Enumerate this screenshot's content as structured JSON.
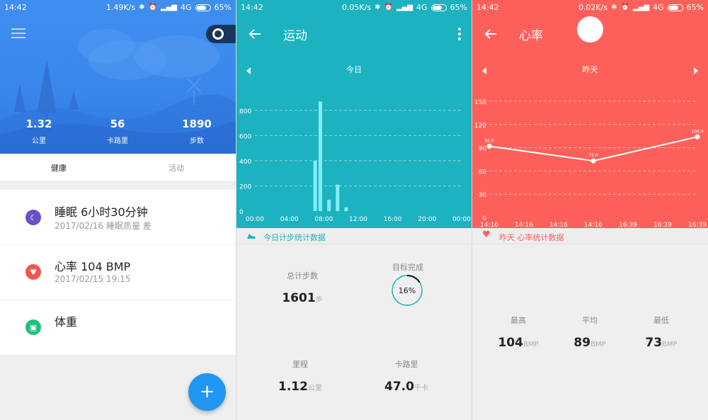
{
  "colors": {
    "blue_header": "#3a86ea",
    "teal": "#1cb2c0",
    "coral": "#fd605a",
    "fab": "#2196f3",
    "bar": "#84edf4"
  },
  "screen1": {
    "status": {
      "time": "14:42",
      "speed": "1.49K/s",
      "network": "4G",
      "battery": "65%"
    },
    "stats": [
      {
        "value": "1.32",
        "label": "公里"
      },
      {
        "value": "56",
        "label": "卡路里"
      },
      {
        "value": "1890",
        "label": "步数"
      }
    ],
    "tabs": [
      {
        "label": "健康"
      },
      {
        "label": "活动"
      }
    ],
    "cards": [
      {
        "icon": "moon-icon",
        "title": "睡眠 6小时30分钟",
        "sub": "2017/02/16 睡眠质量 差"
      },
      {
        "icon": "heart-icon",
        "title": "心率 104 BMP",
        "sub": "2017/02/15 19:15"
      },
      {
        "icon": "scale-icon",
        "title": "体重",
        "sub": ""
      }
    ],
    "fab_label": "+"
  },
  "screen2": {
    "status": {
      "time": "14:42",
      "speed": "0.05K/s",
      "network": "4G",
      "battery": "65%"
    },
    "title": "运动",
    "day_label": "今日",
    "section_label": "今日计步统计数据",
    "total_steps": {
      "label": "总计步数",
      "value": "1601",
      "unit": "步"
    },
    "goal": {
      "label": "目标完成",
      "value": "16%",
      "fraction": 0.16
    },
    "distance": {
      "label": "里程",
      "value": "1.12",
      "unit": "公里"
    },
    "calories": {
      "label": "卡路里",
      "value": "47.0",
      "unit": "千卡"
    }
  },
  "screen3": {
    "status": {
      "time": "14:42",
      "speed": "0.02K/s",
      "network": "4G",
      "battery": "65%"
    },
    "title": "心率",
    "day_label": "昨天",
    "section_label": "昨天 心率统计数据",
    "max": {
      "label": "最高",
      "value": "104",
      "unit": "BMP"
    },
    "avg": {
      "label": "平均",
      "value": "89",
      "unit": "BMP"
    },
    "min": {
      "label": "最低",
      "value": "73",
      "unit": "BMP"
    }
  },
  "chart_data": [
    {
      "type": "bar",
      "x_tick_labels": [
        "00:00",
        "04:00",
        "08:00",
        "12:00",
        "16:00",
        "20:00",
        "00:00"
      ],
      "y_ticks": [
        0,
        200,
        400,
        600,
        800
      ],
      "ylim": [
        0,
        900
      ],
      "xlim": [
        0,
        24
      ],
      "grid": true,
      "series": [
        {
          "x": [
            7.0,
            7.6,
            8.6,
            9.6,
            10.6
          ],
          "values": [
            400,
            870,
            90,
            210,
            30
          ]
        }
      ]
    },
    {
      "type": "line",
      "x_tick_labels": [
        "14:16",
        "14:16",
        "14:16",
        "14:16",
        "16:39",
        "16:39",
        "16:39"
      ],
      "y_ticks": [
        0,
        30,
        60,
        90,
        120,
        150
      ],
      "ylim": [
        0,
        160
      ],
      "grid": true,
      "series": [
        {
          "x": [
            0,
            3,
            6
          ],
          "values": [
            92.0,
            73.0,
            104.0
          ],
          "labels": [
            "92.0",
            "73.0",
            "104.0"
          ]
        }
      ]
    }
  ]
}
